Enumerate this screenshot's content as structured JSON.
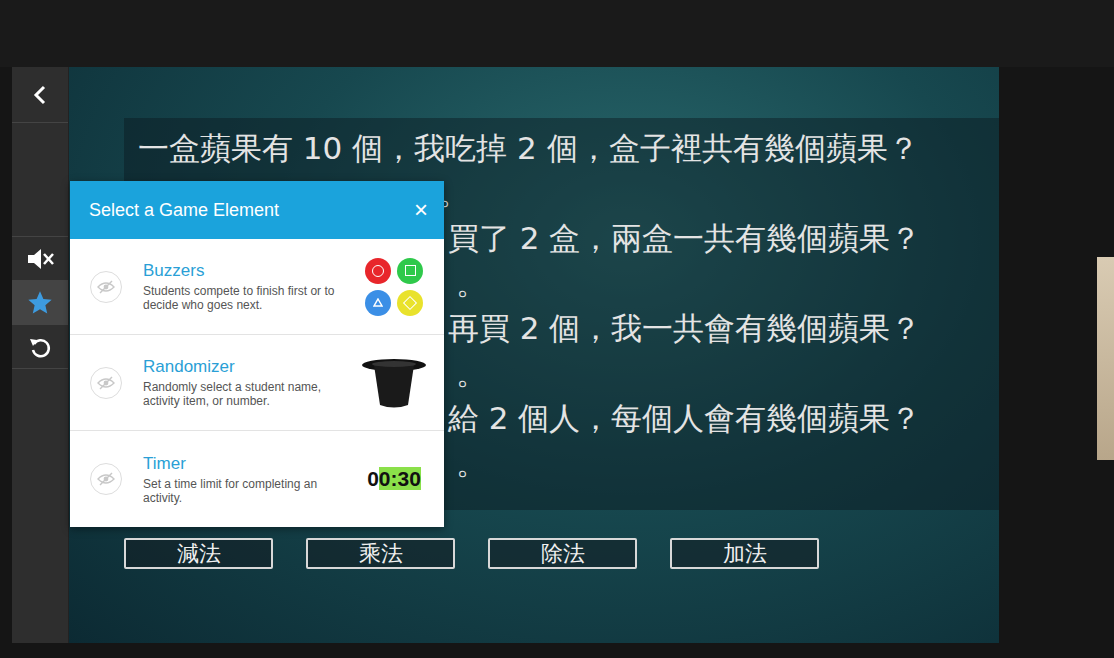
{
  "sidebar": {
    "items": [
      {
        "kind": "back",
        "selected": false
      },
      {
        "kind": "mute",
        "selected": false
      },
      {
        "kind": "star",
        "selected": true
      },
      {
        "kind": "reset",
        "selected": false
      }
    ]
  },
  "questions": [
    {
      "text": "一盒蘋果有 10 個，我吃掉 2 個，盒子裡共有幾個蘋果？",
      "kind": "full",
      "answer": "。"
    },
    {
      "text": "買了 2 盒，兩盒一共有幾個蘋果？",
      "kind": "cut",
      "answer": "。"
    },
    {
      "text": "再買 2 個，我一共會有幾個蘋果？",
      "kind": "cut",
      "answer": "。"
    },
    {
      "text": "給 2 個人，每個人會有幾個蘋果？",
      "kind": "cut",
      "answer": "。"
    }
  ],
  "operation_buttons": [
    "減法",
    "乘法",
    "除法",
    "加法"
  ],
  "dialog": {
    "title": "Select a Game Element",
    "close": "×",
    "elements": [
      {
        "kind": "buzzers",
        "title": "Buzzers",
        "description": "Students compete to finish first or to decide who goes next.",
        "buzzers": [
          {
            "kind": "circle",
            "color": "#e8262b"
          },
          {
            "kind": "square",
            "color": "#2fc94b"
          },
          {
            "kind": "triangle",
            "color": "#3b8fe6"
          },
          {
            "kind": "diamond",
            "color": "#e9e22c"
          }
        ]
      },
      {
        "kind": "randomizer",
        "title": "Randomizer",
        "description": "Randomly select a student name, activity item, or number."
      },
      {
        "kind": "timer",
        "title": "Timer",
        "description": "Set a time limit for completing an activity.",
        "segments": [
          {
            "text": "0",
            "highlighted": false
          },
          {
            "text": "0:30",
            "highlighted": true
          }
        ]
      }
    ]
  }
}
